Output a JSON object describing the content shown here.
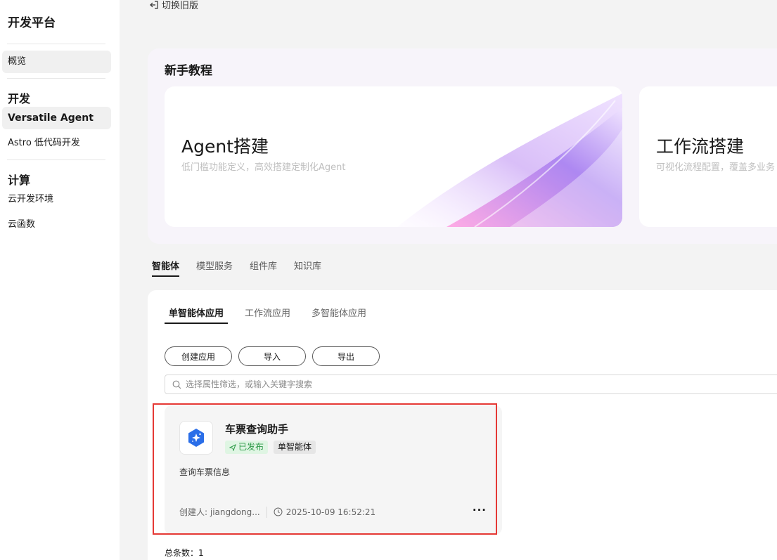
{
  "sidebar": {
    "brand": "开发平台",
    "overview": "概览",
    "section_dev": "开发",
    "versatile": "Versatile Agent",
    "astro": "Astro 低代码开发",
    "section_compute": "计算",
    "cloud_env": "云开发环境",
    "cloud_func": "云函数"
  },
  "header": {
    "switch_old": "切换旧版"
  },
  "tutorial": {
    "title": "新手教程",
    "cards": [
      {
        "title": "Agent搭建",
        "desc": "低门槛功能定义，高效搭建定制化Agent"
      },
      {
        "title": "工作流搭建",
        "desc": "可视化流程配置，覆盖多业务"
      }
    ]
  },
  "tabs": [
    "智能体",
    "模型服务",
    "组件库",
    "知识库"
  ],
  "subtabs": [
    "单智能体应用",
    "工作流应用",
    "多智能体应用"
  ],
  "buttons": {
    "create": "创建应用",
    "import": "导入",
    "export": "导出"
  },
  "search": {
    "placeholder": "选择属性筛选，或输入关键字搜索"
  },
  "agent": {
    "name": "车票查询助手",
    "status": "已发布",
    "type": "单智能体",
    "desc": "查询车票信息",
    "creator": "创建人: jiangdong...",
    "time": "2025-10-09 16:52:21",
    "more": "···"
  },
  "footer": {
    "total": "总条数：1"
  },
  "colors": {
    "accent": "#191919",
    "published_bg": "#dff5e3",
    "published_text": "#2e9a48",
    "highlight": "#e53935",
    "logo_blue": "#2a6ee8"
  }
}
